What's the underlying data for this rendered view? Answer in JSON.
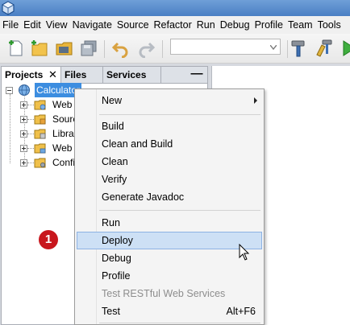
{
  "menubar": {
    "items": [
      "File",
      "Edit",
      "View",
      "Navigate",
      "Source",
      "Refactor",
      "Run",
      "Debug",
      "Profile",
      "Team",
      "Tools"
    ]
  },
  "toolbar": {
    "icons": [
      "new-file-icon",
      "new-project-icon",
      "open-project-icon",
      "save-all-icon",
      "undo-icon",
      "redo-icon",
      "configuration-combo",
      "build-hammer-icon",
      "clean-build-icon",
      "run-icon"
    ]
  },
  "panel": {
    "tabs": {
      "projects": "Projects",
      "files": "Files",
      "services": "Services"
    },
    "close_glyph": "✕",
    "minimize_glyph": "—"
  },
  "tree": {
    "root_label": "Calculator",
    "children": [
      "Web P",
      "Sourc",
      "Librar",
      "Web S",
      "Config"
    ]
  },
  "step_badge": "1",
  "context_menu": {
    "new": "New",
    "build": "Build",
    "clean_build": "Clean and Build",
    "clean": "Clean",
    "verify": "Verify",
    "generate_javadoc": "Generate Javadoc",
    "run": "Run",
    "deploy": "Deploy",
    "debug": "Debug",
    "profile": "Profile",
    "test_restful": "Test RESTful Web Services",
    "test": "Test",
    "test_shortcut": "Alt+F6"
  },
  "colors": {
    "selection": "#3c8de0",
    "menu_hover": "#cde0f5",
    "badge": "#c8161d"
  }
}
